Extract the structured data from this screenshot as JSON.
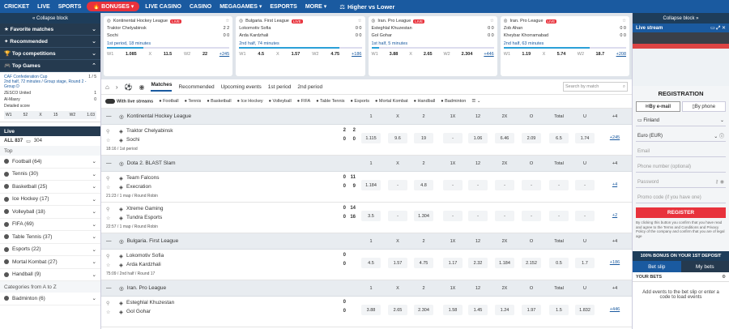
{
  "topnav": {
    "items": [
      "CRICKET",
      "LIVE",
      "SPORTS",
      "BONUSES",
      "LIVE CASINO",
      "CASINO",
      "MEGAGAMES",
      "ESPORTS",
      "MORE"
    ],
    "higher_lower": "Higher vs Lower"
  },
  "left": {
    "collapse": "« Collapse block",
    "favorite": "Favorite matches",
    "recommended": "Recommended",
    "top_competitions": "Top competitions",
    "top_games": "Top Games",
    "top_games_pager": "1 / 5",
    "tg_league": "CAF Confederation Cup",
    "tg_status": "2nd half, 72 minutes / Group stage, Round 2 - Group D",
    "tg_team1": "ZESCO United",
    "tg_team2": "Al-Masry",
    "tg_score1": "1",
    "tg_score2": "0",
    "tg_detailed": "Detailed score",
    "tg_odds": [
      "W1",
      "52",
      "X",
      "15",
      "W2",
      "1.03"
    ],
    "live_label": "Live",
    "all_label": "ALL 837",
    "all_count2": "304",
    "top_label": "Top",
    "sports": [
      {
        "name": "Football (64)"
      },
      {
        "name": "Tennis (30)"
      },
      {
        "name": "Basketball (25)"
      },
      {
        "name": "Ice Hockey (17)"
      },
      {
        "name": "Volleyball (18)"
      },
      {
        "name": "FIFA (69)"
      },
      {
        "name": "Table Tennis (37)"
      },
      {
        "name": "Esports (22)"
      },
      {
        "name": "Mortal Kombat (27)"
      },
      {
        "name": "Handball (9)"
      }
    ],
    "cat_label": "Categories from A to Z",
    "badminton": "Badminton (6)"
  },
  "banner": [
    {
      "league": "Kontinental Hockey League",
      "t1": "Traktor Chelyabinsk",
      "t2": "Sochi",
      "s1": "2 2",
      "s2": "0 0",
      "period": "1st period, 18 minutes",
      "progress": 30,
      "odds": [
        "W1",
        "1.085",
        "X",
        "11.5",
        "W2",
        "22",
        "+245"
      ]
    },
    {
      "league": "Bulgaria. First League",
      "t1": "Lokomotiv Sofia",
      "t2": "Arda Kardzhali",
      "s1": "0 0",
      "s2": "0 0",
      "period": "2nd half, 74 minutes",
      "progress": 82,
      "odds": [
        "W1",
        "4.5",
        "X",
        "1.57",
        "W2",
        "4.75",
        "+186"
      ]
    },
    {
      "league": "Iran. Pro League",
      "t1": "Esteghlal Khuzestan",
      "t2": "Gol Gohar",
      "s1": "0 0",
      "s2": "0 0",
      "period": "1st half, 5 minutes",
      "progress": 6,
      "odds": [
        "W1",
        "3.88",
        "X",
        "2.65",
        "W2",
        "2.304",
        "+446"
      ]
    },
    {
      "league": "Iran. Pro League",
      "t1": "Zob Ahan",
      "t2": "Kheybar Khorramabad",
      "s1": "0 0",
      "s2": "0 0",
      "period": "2nd half, 63 minutes",
      "progress": 70,
      "odds": [
        "W1",
        "1.19",
        "X",
        "5.74",
        "W2",
        "18.7",
        "+208"
      ]
    }
  ],
  "main": {
    "tabs": [
      "Matches",
      "Recommended",
      "Upcoming events",
      "1st period",
      "2nd period"
    ],
    "search_placeholder": "Search by match",
    "with_live_streams": "With live streams",
    "sport_tabs": [
      "Football",
      "Tennis",
      "Basketball",
      "Ice Hockey",
      "Volleyball",
      "FIFA",
      "Table Tennis",
      "Esports",
      "Mortal Kombat",
      "Handball",
      "Badminton"
    ],
    "cols": [
      "1",
      "X",
      "2",
      "1X",
      "12",
      "2X",
      "O",
      "Total",
      "U"
    ],
    "plus4": "+4",
    "leagues": [
      {
        "name": "Kontinental Hockey League",
        "events": [
          {
            "t1": "Traktor Chelyabinsk",
            "t2": "Sochi",
            "sa1": "2",
            "sb1": "2",
            "sa2": "0",
            "sb2": "0",
            "info": "18:16 / 1st period",
            "odds": [
              "1.115",
              "9.6",
              "19",
              "-",
              "1.06",
              "6.46",
              "2.09",
              "6.5",
              "1.74"
            ],
            "more": "+245"
          }
        ]
      },
      {
        "name": "Dota 2. BLAST Slam",
        "events": [
          {
            "t1": "Team Falcons",
            "t2": "Execration",
            "sa1": "0",
            "sb1": "11",
            "sa2": "0",
            "sb2": "9",
            "info": "21:23 / 1 map / Round Robin",
            "odds": [
              "1.184",
              "-",
              "4.8",
              "-",
              "-",
              "-",
              "-",
              "-",
              "-"
            ],
            "more": "+4"
          },
          {
            "t1": "Xtreme Gaming",
            "t2": "Tundra Esports",
            "sa1": "0",
            "sb1": "14",
            "sa2": "0",
            "sb2": "16",
            "info": "22:57 / 1 map / Round Robin",
            "odds": [
              "3.5",
              "-",
              "1.304",
              "-",
              "-",
              "-",
              "-",
              "-",
              "-"
            ],
            "more": "+2"
          }
        ]
      },
      {
        "name": "Bulgaria. First League",
        "events": [
          {
            "t1": "Lokomotiv Sofia",
            "t2": "Arda Kardzhali",
            "sa1": "0",
            "sb1": "",
            "sa2": "0",
            "sb2": "",
            "info": "75:09 / 2nd half / Round 17",
            "odds": [
              "4.5",
              "1.57",
              "4.75",
              "1.17",
              "2.32",
              "1.184",
              "2.152",
              "0.5",
              "1.7"
            ],
            "more": "+186"
          }
        ]
      },
      {
        "name": "Iran. Pro League",
        "events": [
          {
            "t1": "Esteghlal Khuzestan",
            "t2": "Gol Gohar",
            "sa1": "0",
            "sb1": "",
            "sa2": "0",
            "sb2": "",
            "info": "",
            "odds": [
              "3.88",
              "2.65",
              "2.304",
              "1.58",
              "1.45",
              "1.24",
              "1.97",
              "1.5",
              "1.832"
            ],
            "more": "+446"
          }
        ]
      }
    ]
  },
  "right": {
    "collapse": "Collapse block »",
    "live_stream": "Live stream",
    "registration": "REGISTRATION",
    "by_email": "By e-mail",
    "by_phone": "By phone",
    "country": "Finland",
    "currency": "Euro (EUR)",
    "email_ph": "Email",
    "phone_ph": "Phone number (optional)",
    "password_ph": "Password",
    "promo_ph": "Promo code (if you have one)",
    "register": "REGISTER",
    "fine": "By clicking this button you confirm that you have read and agree to the Terms and Conditions and Privacy Policy of the company and confirm that you are of legal age",
    "bonus": "100% BONUS ON YOUR 1ST DEPOSIT",
    "bet_slip": "Bet slip",
    "my_bets": "My bets",
    "your_bets": "YOUR BETS",
    "add_events": "Add events to the bet slip or enter a code to load events"
  },
  "colors": {
    "brand": "#1a5aa0",
    "accent": "#e8323c",
    "dark": "#253a4f"
  }
}
